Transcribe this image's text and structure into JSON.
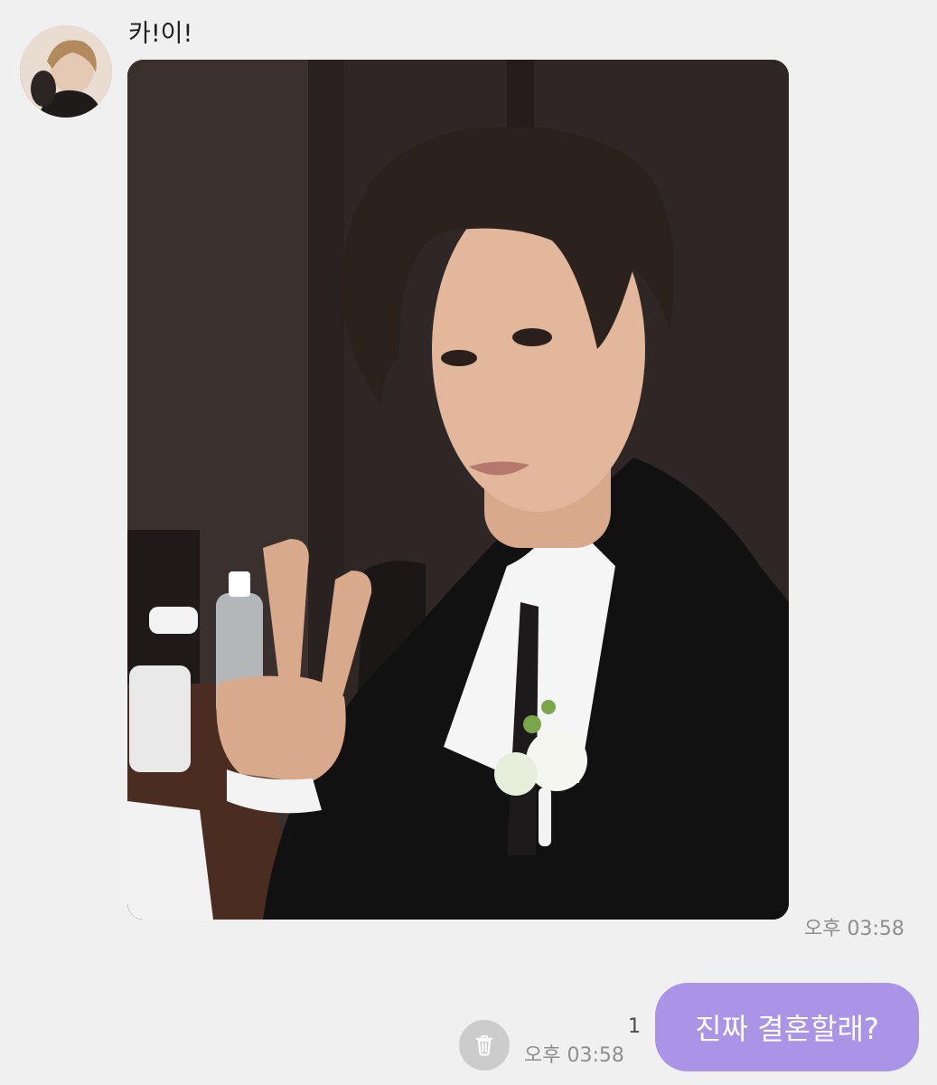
{
  "chat": {
    "sender_name": "카!이!",
    "incoming_photo_time": "오후 03:58",
    "outgoing": {
      "text": "진짜 결혼할래?",
      "unread_count": "1",
      "time": "오후 03:58"
    }
  },
  "icons": {
    "delete": "trash-icon"
  },
  "colors": {
    "background": "#f0f0f0",
    "outgoing_bubble": "#a994e8",
    "timestamp": "#8e8e8e",
    "trash_button": "#cccccc"
  }
}
